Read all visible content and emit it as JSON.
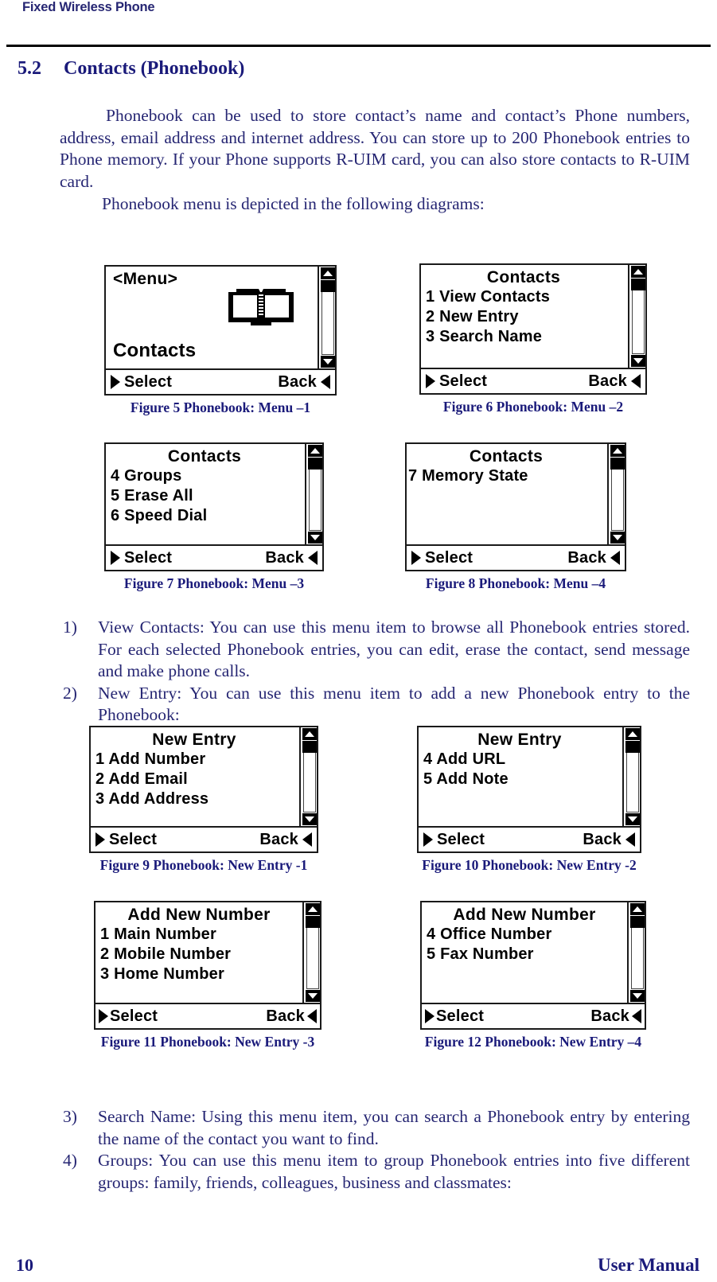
{
  "header": {
    "title": "Fixed Wireless Phone"
  },
  "section": {
    "number": "5.2",
    "title": "Contacts (Phonebook)"
  },
  "intro_paragraph": "Phonebook can be used to store contact’s name and contact’s Phone numbers, address,  email address and internet address. You can store up to 200 Phonebook entries to Phone memory. If your Phone supports R-UIM card, you can also store contacts to R-UIM card.",
  "depict_paragraph": "Phonebook menu is depicted in the following diagrams:",
  "softkeys": {
    "select": "Select",
    "back": "Back"
  },
  "figures": [
    {
      "id": "figure-5",
      "caption": "Figure 5 Phonebook: Menu –1",
      "screen": {
        "title": "<Menu>",
        "title_align": "left",
        "big_word": "Contacts",
        "icon": "open-book-icon",
        "items": []
      }
    },
    {
      "id": "figure-6",
      "caption": "Figure 6 Phonebook: Menu –2",
      "screen": {
        "title": "Contacts",
        "title_align": "center",
        "items": [
          "1 View Contacts",
          "2 New Entry",
          "3 Search Name"
        ]
      }
    },
    {
      "id": "figure-7",
      "caption": "Figure 7 Phonebook: Menu –3",
      "screen": {
        "title": "Contacts",
        "title_align": "center",
        "items": [
          "4 Groups",
          "5 Erase All",
          "6 Speed Dial"
        ]
      }
    },
    {
      "id": "figure-8",
      "caption": "Figure 8 Phonebook: Menu –4",
      "screen": {
        "title": "Contacts",
        "title_align": "center",
        "items": [
          "7 Memory State"
        ]
      }
    },
    {
      "id": "figure-9",
      "caption": "Figure 9 Phonebook: New Entry -1",
      "screen": {
        "title": "New Entry",
        "title_align": "center",
        "items": [
          "1 Add Number",
          "2 Add Email",
          "3 Add Address"
        ]
      }
    },
    {
      "id": "figure-10",
      "caption": "Figure 10 Phonebook: New Entry -2",
      "screen": {
        "title": "New Entry",
        "title_align": "center",
        "items": [
          "4 Add URL",
          "5 Add Note"
        ]
      }
    },
    {
      "id": "figure-11",
      "caption": "Figure 11 Phonebook: New Entry -3",
      "screen": {
        "title": "Add New Number",
        "title_align": "center",
        "items": [
          "1 Main Number",
          "2 Mobile Number",
          "3 Home Number"
        ]
      }
    },
    {
      "id": "figure-12",
      "caption": "Figure 12 Phonebook: New Entry –4",
      "screen": {
        "title": "Add New Number",
        "title_align": "center",
        "items": [
          "4 Office Number",
          "5 Fax Number"
        ]
      }
    }
  ],
  "list_top": [
    {
      "marker": "1)",
      "text": "View Contacts: You can use this menu item to browse all Phonebook entries stored. For each selected Phonebook entries, you can edit, erase  the contact, send message and make phone calls."
    },
    {
      "marker": "2)",
      "text": "New Entry: You can use this menu item to add a new Phonebook entry to the Phonebook:"
    }
  ],
  "list_bottom": [
    {
      "marker": "3)",
      "text": "Search Name: Using this menu item, you can search a Phonebook entry by entering the name of the contact you want to find."
    },
    {
      "marker": "4)",
      "text": "Groups:  You can use this menu item to group Phonebook entries into five different groups: family, friends, colleagues, business and classmates:"
    }
  ],
  "footer": {
    "page_number": "10",
    "label": "User Manual"
  },
  "colors": {
    "text_blue": "#262673",
    "heading_blue": "#1a1a7a",
    "rule_black": "#000000"
  }
}
